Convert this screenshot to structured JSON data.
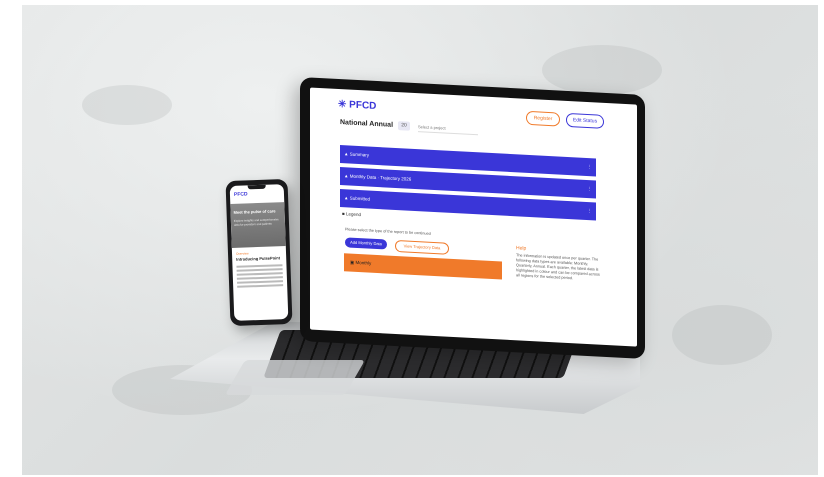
{
  "laptop_screen": {
    "logo": "PFCD",
    "register_label": "Register",
    "edit_label": "Edit Status",
    "page_title": "National Annual",
    "mini_select": "20",
    "select_value": "Select a project",
    "sections": [
      {
        "label": "Summary"
      },
      {
        "label": "Monthly Data · Trajectory 2026"
      },
      {
        "label": "Submitted"
      }
    ],
    "legend_text": "Legend",
    "instruction_text": "Please select the type of the report to be continued",
    "button_primary": "Add Monthly Data",
    "button_secondary": "View Trajectory Data",
    "orange_row": "Monthly",
    "side_heading": "Help",
    "side_text": "The information is updated once per quarter. The following data types are available: Monthly, Quarterly, Annual. Each quarter, the latest data is highlighted in colour and can be compared across all regions for the selected period."
  },
  "phone_screen": {
    "logo": "PFCD",
    "hero_title": "Meet the pulse of care",
    "hero_subtitle": "Explore insights and comprehensive data for providers and patients",
    "tag": "Overview",
    "heading": "Introducing PulsePoint"
  }
}
